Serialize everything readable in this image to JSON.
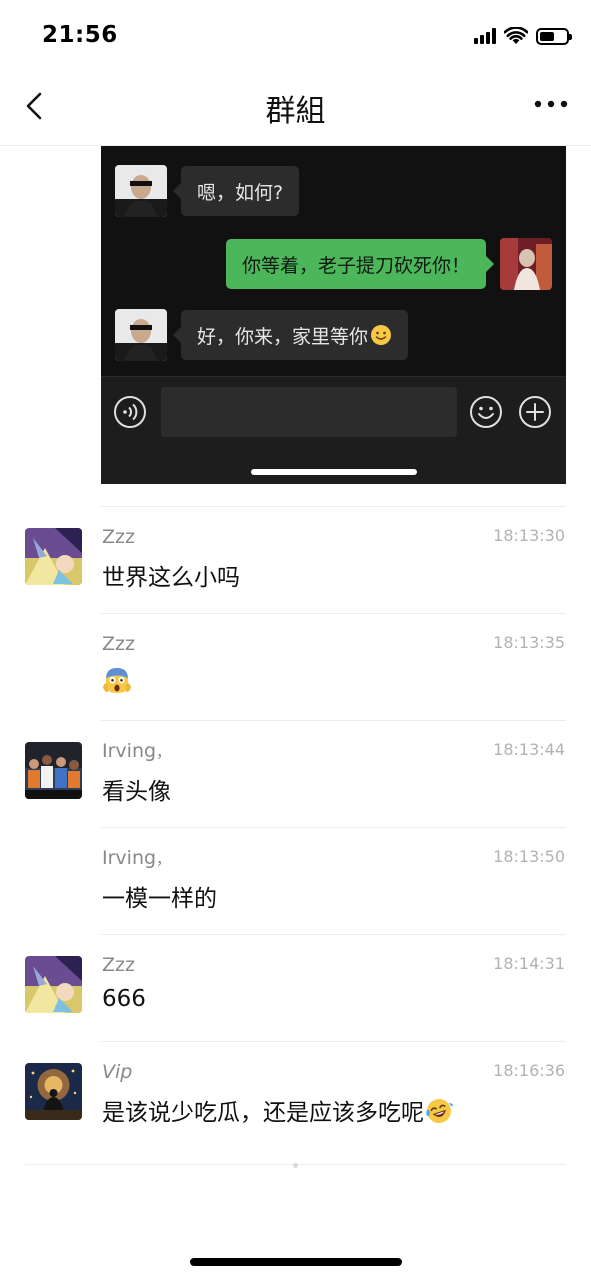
{
  "status_bar": {
    "time": "21:56",
    "icons": [
      "signal-icon",
      "wifi-icon",
      "battery-icon"
    ]
  },
  "nav": {
    "title": "群組",
    "back_icon": "chevron-left-icon",
    "more_icon": "more-dots-icon"
  },
  "screenshot": {
    "background": "#111111",
    "messages": [
      {
        "side": "left",
        "text": "嗯，如何?"
      },
      {
        "side": "right",
        "text": "你等着，老子提刀砍死你！"
      },
      {
        "side": "left",
        "text": "好，你来，家里等你",
        "emoji": "smile-emoji"
      }
    ],
    "input_bar": {
      "icons": [
        "voice-icon",
        "sticker-icon",
        "plus-icon"
      ]
    }
  },
  "messages": [
    {
      "sender": "Zzz",
      "time": "18:13:30",
      "text": "世界这么小吗",
      "avatar": "anime-avatar"
    },
    {
      "sender": "Zzz",
      "time": "18:13:35",
      "text": "",
      "emoji": "screaming-face-emoji"
    },
    {
      "sender": "Irving",
      "sender_suffix": "，",
      "time": "18:13:44",
      "text": "看头像",
      "avatar": "team-photo-avatar"
    },
    {
      "sender": "Irving",
      "sender_suffix": "，",
      "time": "18:13:50",
      "text": "一模一样的"
    },
    {
      "sender": "Zzz",
      "time": "18:14:31",
      "text": "666",
      "avatar": "anime-avatar"
    },
    {
      "sender": "Vip",
      "time": "18:16:36",
      "text": "是该说少吃瓜，还是应该多吃呢",
      "emoji": "laughing-tears-emoji",
      "avatar": "meditation-avatar"
    }
  ],
  "colors": {
    "accent_green": "#4cb75a",
    "meta_gray": "#888888",
    "time_gray": "#b2b2b2",
    "divider": "#ececec"
  }
}
